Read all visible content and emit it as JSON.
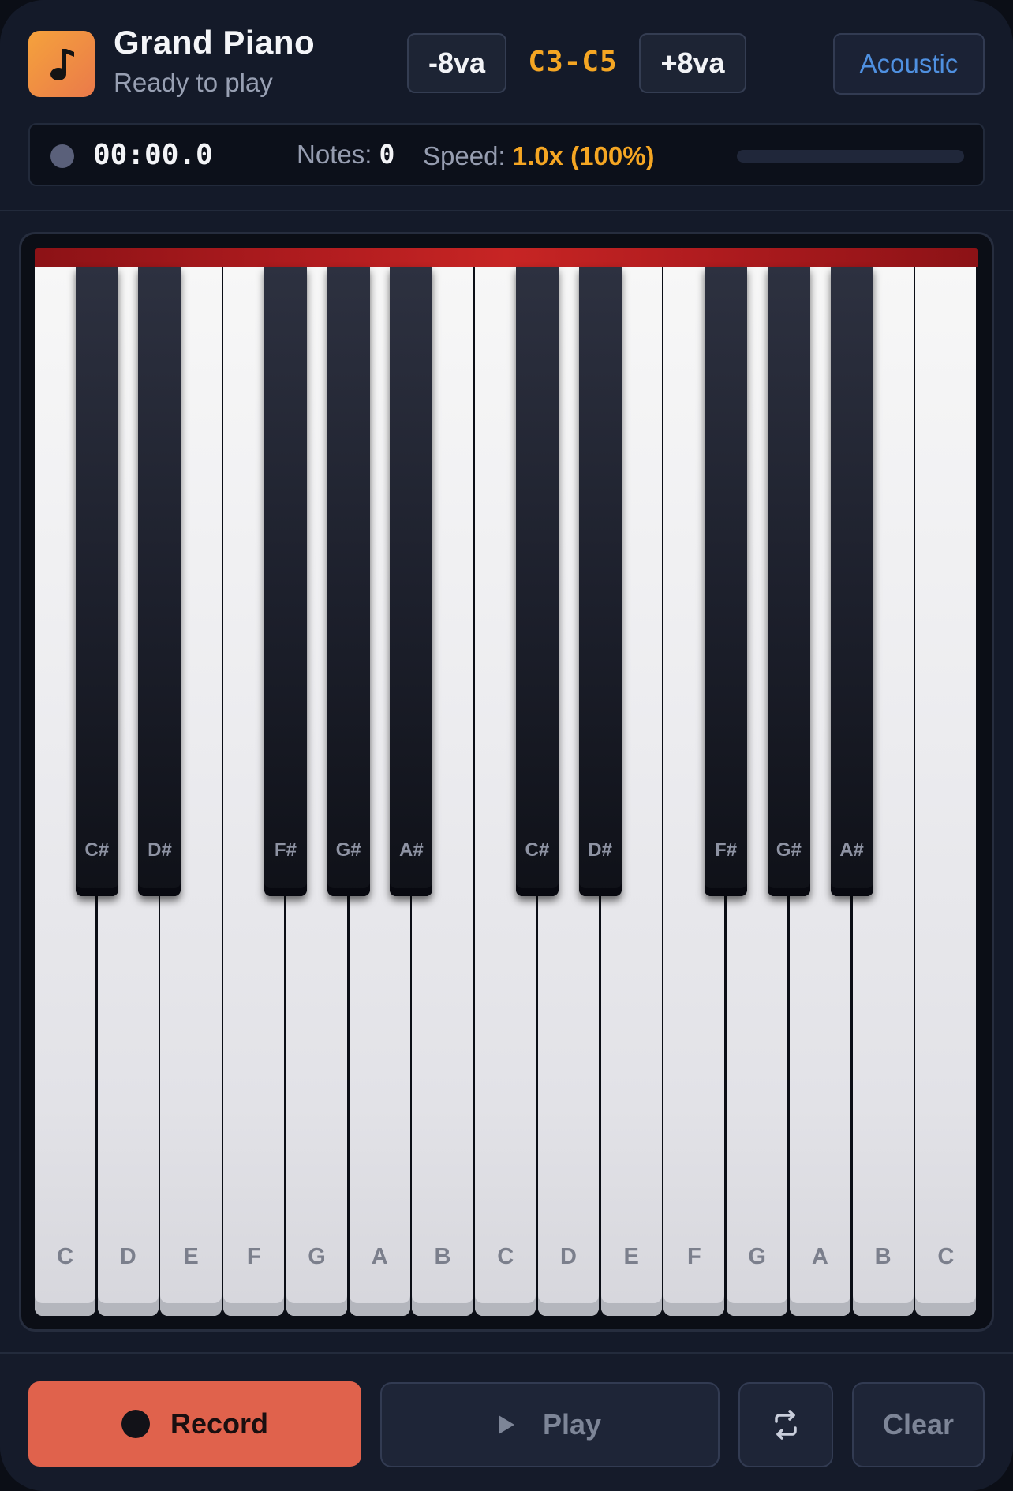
{
  "header": {
    "title": "Grand Piano",
    "subtitle": "Ready to play",
    "octave_down_label": "-8va",
    "range_label": "C3-C5",
    "octave_up_label": "+8va",
    "mode_label": "Acoustic"
  },
  "status": {
    "timer": "00:00.0",
    "notes_label": "Notes:",
    "notes_value": "0",
    "speed_label": "Speed:",
    "speed_value": "1.0x (100%)",
    "progress": 0
  },
  "piano": {
    "white_keys": [
      "C",
      "D",
      "E",
      "F",
      "G",
      "A",
      "B",
      "C",
      "D",
      "E",
      "F",
      "G",
      "A",
      "B",
      "C"
    ],
    "black_keys": [
      "C#",
      "D#",
      "F#",
      "G#",
      "A#",
      "C#",
      "D#",
      "F#",
      "G#",
      "A#"
    ]
  },
  "controls": {
    "record_label": "Record",
    "play_label": "Play",
    "clear_label": "Clear"
  },
  "icons": {
    "app": "music-note-icon",
    "loop": "repeat-icon"
  },
  "colors": {
    "accent": "#f5a623",
    "record": "#e0624c",
    "mode": "#4f90e0",
    "felt": "#c72524"
  }
}
